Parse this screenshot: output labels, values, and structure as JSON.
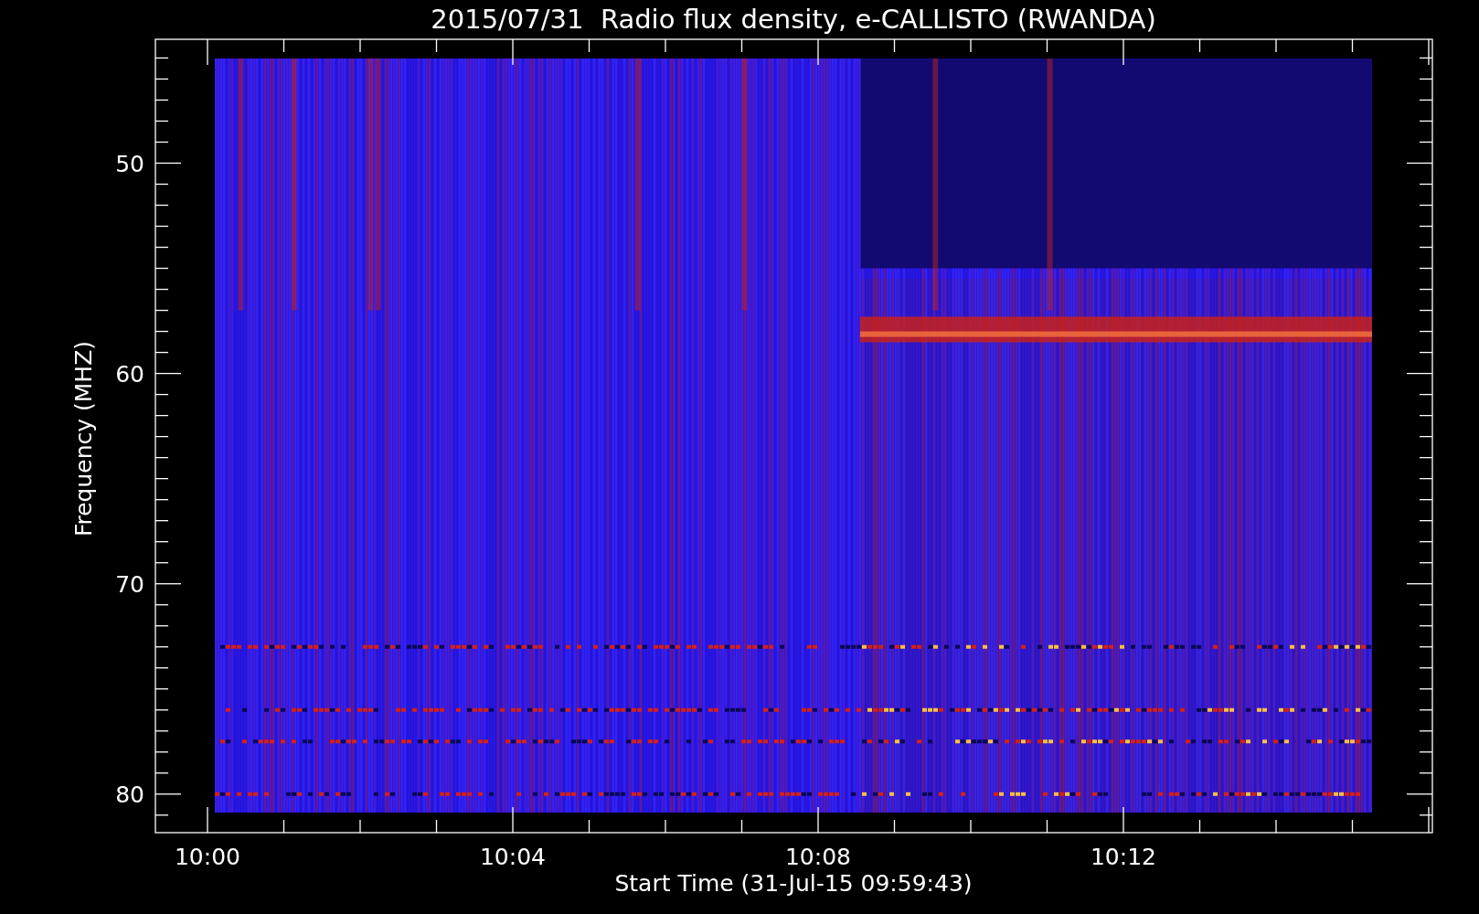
{
  "title": "2015/07/31  Radio flux density, e-CALLISTO (RWANDA)",
  "y_axis": {
    "label": "Frequency (MHZ)",
    "ticks": [
      "50",
      "60",
      "70",
      "80"
    ]
  },
  "x_axis": {
    "label": "Start Time (31-Jul-15 09:59:43)",
    "ticks": [
      "10:00",
      "10:04",
      "10:08",
      "10:12"
    ]
  }
}
